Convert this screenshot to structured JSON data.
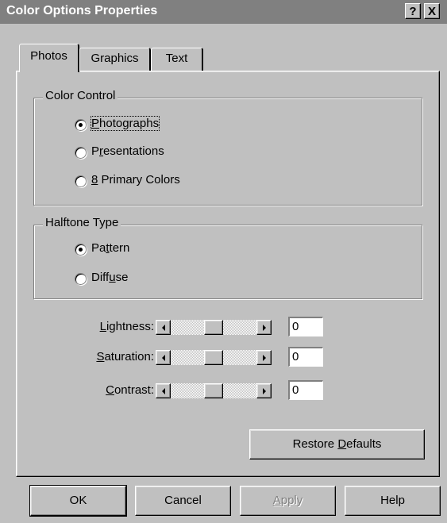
{
  "window": {
    "title": "Color Options Properties",
    "help_button": "?",
    "close_button": "X"
  },
  "tabs": [
    {
      "label": "Photos",
      "active": true
    },
    {
      "label": "Graphics",
      "active": false
    },
    {
      "label": "Text",
      "active": false
    }
  ],
  "color_control": {
    "legend": "Color Control",
    "options": [
      {
        "before": "",
        "mnemonic": "P",
        "after": "hotographs",
        "selected": true
      },
      {
        "before": "P",
        "mnemonic": "r",
        "after": "esentations",
        "selected": false
      },
      {
        "before": "",
        "mnemonic": "8",
        "after": " Primary Colors",
        "selected": false
      }
    ]
  },
  "halftone_type": {
    "legend": "Halftone Type",
    "options": [
      {
        "before": "Pa",
        "mnemonic": "t",
        "after": "tern",
        "selected": true
      },
      {
        "before": "Diff",
        "mnemonic": "u",
        "after": "se",
        "selected": false
      }
    ]
  },
  "sliders": [
    {
      "mnemonic": "L",
      "after": "ightness:",
      "value": "0",
      "level": 0.5
    },
    {
      "mnemonic": "S",
      "after": "aturation:",
      "value": "0",
      "level": 0.5
    },
    {
      "mnemonic": "C",
      "after": "ontrast:",
      "value": "0",
      "level": 0.5
    }
  ],
  "restore_defaults": {
    "before": "Restore ",
    "mnemonic": "D",
    "after": "efaults"
  },
  "footer": {
    "ok": "OK",
    "cancel": "Cancel",
    "apply_mnemonic": "A",
    "apply_after": "pply",
    "help": "Help"
  },
  "icons": {
    "left_arrow": "left-arrow-icon",
    "right_arrow": "right-arrow-icon"
  },
  "colors": {
    "face": "#c0c0c0",
    "titlebar": "#808080"
  }
}
